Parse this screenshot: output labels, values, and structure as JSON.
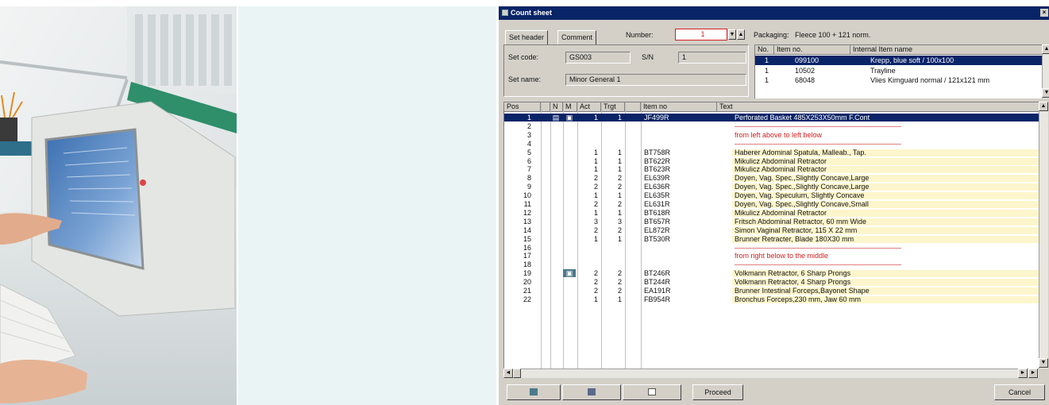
{
  "window": {
    "title": "Count sheet"
  },
  "tabs": [
    {
      "label": "Set header"
    },
    {
      "label": "Comment"
    }
  ],
  "header": {
    "number_label": "Number:",
    "number_value": "1",
    "packaging_label": "Packaging:",
    "packaging_value": "Fleece 100 + 121 norm.",
    "set_code_label": "Set code:",
    "set_code_value": "GS003",
    "sn_label": "S/N",
    "sn_value": "1",
    "set_name_label": "Set name:",
    "set_name_value": "Minor General 1"
  },
  "packaging_table": {
    "columns": [
      "No.",
      "Item no.",
      "Internal Item name"
    ],
    "rows": [
      {
        "no": "1",
        "item_no": "099100",
        "name": "Krepp, blue soft / 100x100",
        "selected": true
      },
      {
        "no": "1",
        "item_no": "10502",
        "name": "Trayline",
        "selected": false
      },
      {
        "no": "1",
        "item_no": "68048",
        "name": "Vlies Kimguard normal / 121x121 mm",
        "selected": false
      }
    ]
  },
  "main_table": {
    "columns": [
      "Pos",
      "N",
      "M",
      "Act",
      "Trgt",
      "Item no",
      "Text"
    ],
    "rows": [
      {
        "pos": "1",
        "n": "▤",
        "m": "▣",
        "act": "1",
        "trgt": "1",
        "item": "JF499R",
        "text": "Perforated Basket 485X253X50mm F.Cont",
        "kind": "selected"
      },
      {
        "pos": "2",
        "n": "",
        "m": "",
        "act": "",
        "trgt": "",
        "item": "",
        "text": "",
        "kind": "redline"
      },
      {
        "pos": "3",
        "n": "",
        "m": "",
        "act": "",
        "trgt": "",
        "item": "",
        "text": "from left above to left below",
        "kind": "red"
      },
      {
        "pos": "4",
        "n": "",
        "m": "",
        "act": "",
        "trgt": "",
        "item": "",
        "text": "",
        "kind": "redline"
      },
      {
        "pos": "5",
        "n": "",
        "m": "",
        "act": "1",
        "trgt": "1",
        "item": "BT758R",
        "text": "Haberer Adominal Spatula, Malleab., Tap.",
        "kind": "item"
      },
      {
        "pos": "6",
        "n": "",
        "m": "",
        "act": "1",
        "trgt": "1",
        "item": "BT622R",
        "text": "Mikulicz Abdominal Retractor",
        "kind": "item"
      },
      {
        "pos": "7",
        "n": "",
        "m": "",
        "act": "1",
        "trgt": "1",
        "item": "BT623R",
        "text": "Mikulicz Abdominal Retractor",
        "kind": "item"
      },
      {
        "pos": "8",
        "n": "",
        "m": "",
        "act": "2",
        "trgt": "2",
        "item": "EL639R",
        "text": "Doyen, Vag. Spec.,Slightly Concave,Large",
        "kind": "item"
      },
      {
        "pos": "9",
        "n": "",
        "m": "",
        "act": "2",
        "trgt": "2",
        "item": "EL636R",
        "text": "Doyen, Vag. Spec.,Slightly Concave,Large",
        "kind": "item"
      },
      {
        "pos": "10",
        "n": "",
        "m": "",
        "act": "1",
        "trgt": "1",
        "item": "EL635R",
        "text": "Doyen, Vag. Speculum, Slightly Concave",
        "kind": "item"
      },
      {
        "pos": "11",
        "n": "",
        "m": "",
        "act": "2",
        "trgt": "2",
        "item": "EL631R",
        "text": "Doyen, Vag. Spec.,Slightly Concave,Small",
        "kind": "item"
      },
      {
        "pos": "12",
        "n": "",
        "m": "",
        "act": "1",
        "trgt": "1",
        "item": "BT618R",
        "text": "Mikulicz Abdominal Retractor",
        "kind": "item"
      },
      {
        "pos": "13",
        "n": "",
        "m": "",
        "act": "3",
        "trgt": "3",
        "item": "BT657R",
        "text": "Fritsch Abdominal Retractor, 60 mm Wide",
        "kind": "item"
      },
      {
        "pos": "14",
        "n": "",
        "m": "",
        "act": "2",
        "trgt": "2",
        "item": "EL872R",
        "text": "Simon Vaginal Retractor, 115 X 22 mm",
        "kind": "item"
      },
      {
        "pos": "15",
        "n": "",
        "m": "",
        "act": "1",
        "trgt": "1",
        "item": "BT530R",
        "text": "Brunner Retracter, Blade 180X30 mm",
        "kind": "item"
      },
      {
        "pos": "16",
        "n": "",
        "m": "",
        "act": "",
        "trgt": "",
        "item": "",
        "text": "",
        "kind": "redline"
      },
      {
        "pos": "17",
        "n": "",
        "m": "",
        "act": "",
        "trgt": "",
        "item": "",
        "text": "from right below to the middle",
        "kind": "red"
      },
      {
        "pos": "18",
        "n": "",
        "m": "",
        "act": "",
        "trgt": "",
        "item": "",
        "text": "",
        "kind": "redline"
      },
      {
        "pos": "19",
        "n": "",
        "m": "▣",
        "act": "2",
        "trgt": "2",
        "item": "BT246R",
        "text": "Volkmann Retractor, 6 Sharp Prongs",
        "kind": "item"
      },
      {
        "pos": "20",
        "n": "",
        "m": "",
        "act": "2",
        "trgt": "2",
        "item": "BT244R",
        "text": "Volkmann Retractor, 4 Sharp Prongs",
        "kind": "item"
      },
      {
        "pos": "21",
        "n": "",
        "m": "",
        "act": "2",
        "trgt": "2",
        "item": "EA191R",
        "text": "Brunner Intestinal Forceps,Bayonet Shape",
        "kind": "item"
      },
      {
        "pos": "22",
        "n": "",
        "m": "",
        "act": "1",
        "trgt": "1",
        "item": "FB954R",
        "text": "Bronchus Forceps,230 mm, Jaw 60 mm",
        "kind": "item"
      }
    ]
  },
  "buttons": {
    "proceed": "Proceed",
    "cancel": "Cancel"
  },
  "colors": {
    "title_bar": "#0a2468",
    "selection": "#0a2468",
    "highlight_row": "#fdf6cc",
    "section_text": "#d02020",
    "pale_panel": "#eaf4f4"
  }
}
